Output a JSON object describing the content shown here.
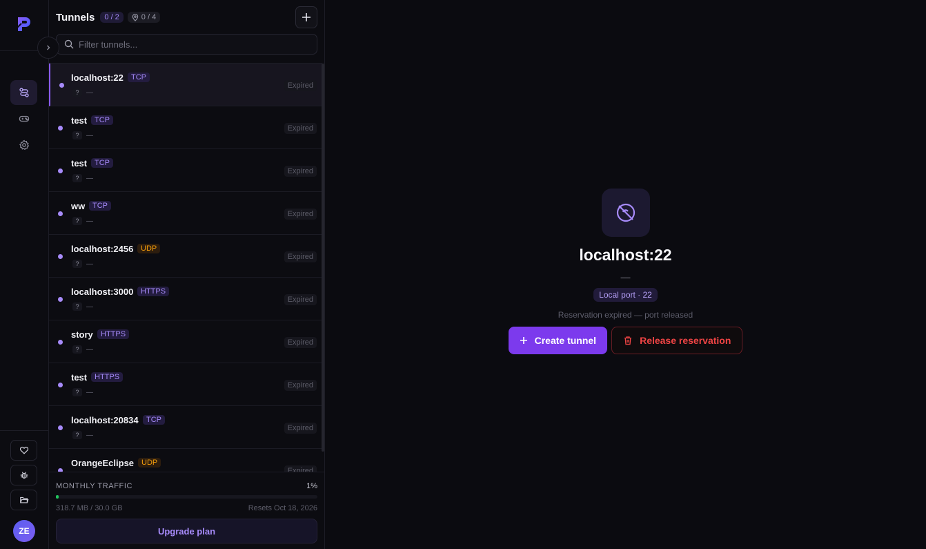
{
  "header": {
    "title": "Tunnels",
    "tunnel_count": "0 / 2",
    "location_count": "0 / 4"
  },
  "search": {
    "placeholder": "Filter tunnels..."
  },
  "tunnels": [
    {
      "name": "localhost:22",
      "protocol": "TCP",
      "sub_q": "?",
      "sub_dash": "—",
      "status": "Expired"
    },
    {
      "name": "test",
      "protocol": "TCP",
      "sub_q": "?",
      "sub_dash": "—",
      "status": "Expired"
    },
    {
      "name": "test",
      "protocol": "TCP",
      "sub_q": "?",
      "sub_dash": "—",
      "status": "Expired"
    },
    {
      "name": "ww",
      "protocol": "TCP",
      "sub_q": "?",
      "sub_dash": "—",
      "status": "Expired"
    },
    {
      "name": "localhost:2456",
      "protocol": "UDP",
      "sub_q": "?",
      "sub_dash": "—",
      "status": "Expired"
    },
    {
      "name": "localhost:3000",
      "protocol": "HTTPS",
      "sub_q": "?",
      "sub_dash": "—",
      "status": "Expired"
    },
    {
      "name": "story",
      "protocol": "HTTPS",
      "sub_q": "?",
      "sub_dash": "—",
      "status": "Expired"
    },
    {
      "name": "test",
      "protocol": "HTTPS",
      "sub_q": "?",
      "sub_dash": "—",
      "status": "Expired"
    },
    {
      "name": "localhost:20834",
      "protocol": "TCP",
      "sub_q": "?",
      "sub_dash": "—",
      "status": "Expired"
    },
    {
      "name": "OrangeEclipse",
      "protocol": "UDP",
      "sub_q": "?",
      "sub_dash": "—",
      "status": "Expired"
    }
  ],
  "traffic": {
    "label": "MONTHLY TRAFFIC",
    "percent": "1%",
    "fill_fraction": 0.01,
    "used": "318.7 MB / 30.0 GB",
    "reset": "Resets Oct 18, 2026",
    "upgrade_label": "Upgrade plan"
  },
  "detail": {
    "title": "localhost:22",
    "dash": "—",
    "port_badge": "Local port · 22",
    "note": "Reservation expired — port released",
    "create_label": "Create tunnel",
    "release_label": "Release reservation"
  },
  "user": {
    "initials": "ZE"
  },
  "colors": {
    "accent": "#7c3aed",
    "accent_text": "#a78bfa",
    "danger": "#ef4444",
    "udp": "#f59e0b",
    "traffic_fill": "#22c55e"
  }
}
